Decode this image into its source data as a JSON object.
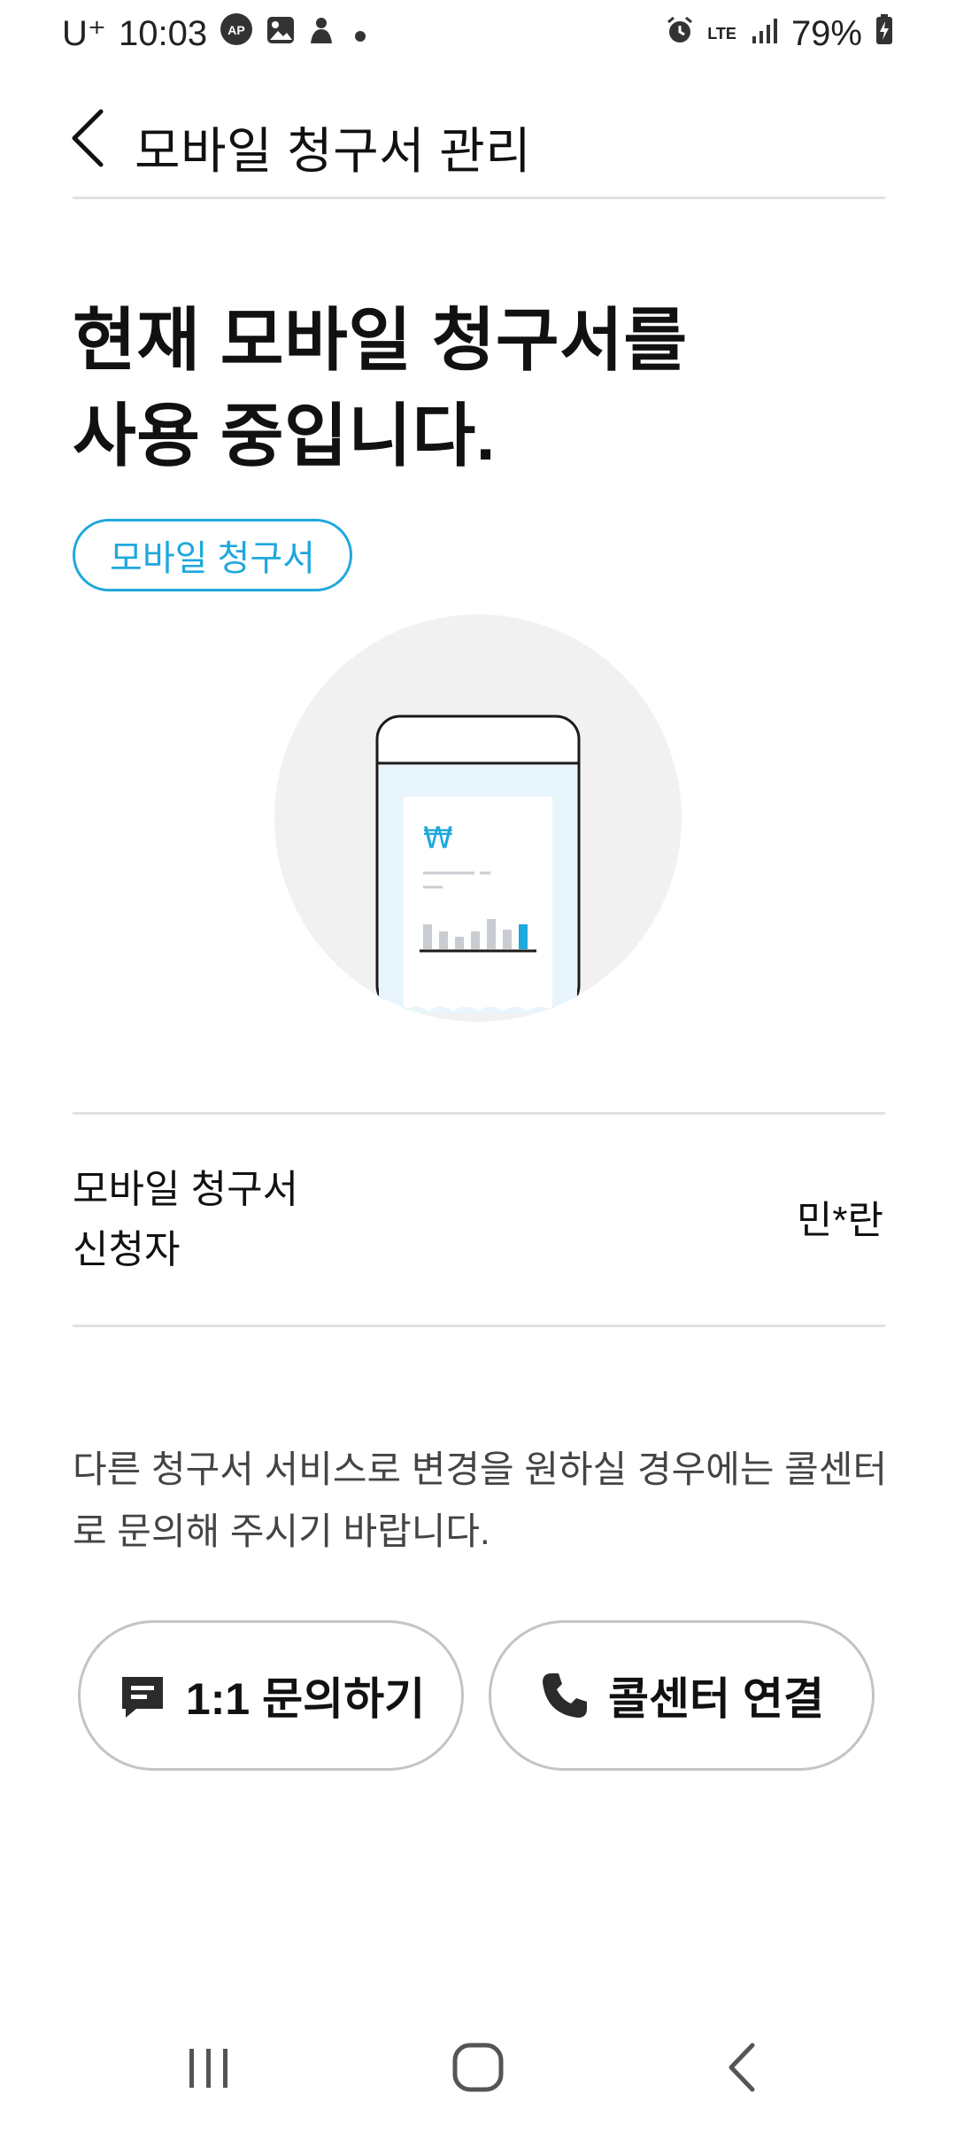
{
  "status_bar": {
    "carrier": "U⁺",
    "time": "10:03",
    "network": "LTE",
    "battery": "79%"
  },
  "header": {
    "title": "모바일 청구서 관리"
  },
  "hero": {
    "line1": "현재 모바일 청구서를",
    "line2": "사용 중입니다."
  },
  "chip": {
    "label": "모바일 청구서"
  },
  "illustration": {
    "currency_symbol": "₩"
  },
  "info": {
    "label_line1": "모바일 청구서",
    "label_line2": "신청자",
    "value": "민*란"
  },
  "notice": {
    "text": "다른 청구서 서비스로 변경을 원하실 경우에는 콜센터로 문의해 주시기 바랍니다."
  },
  "actions": {
    "inquiry_label": "1:1 문의하기",
    "call_label": "콜센터 연결"
  },
  "colors": {
    "accent": "#1fa8dc",
    "divider": "#e1e1e1",
    "button_border": "#c4c4c4"
  },
  "icons": {
    "back": "chevron-left-icon",
    "chat": "chat-icon",
    "phone": "phone-icon"
  }
}
